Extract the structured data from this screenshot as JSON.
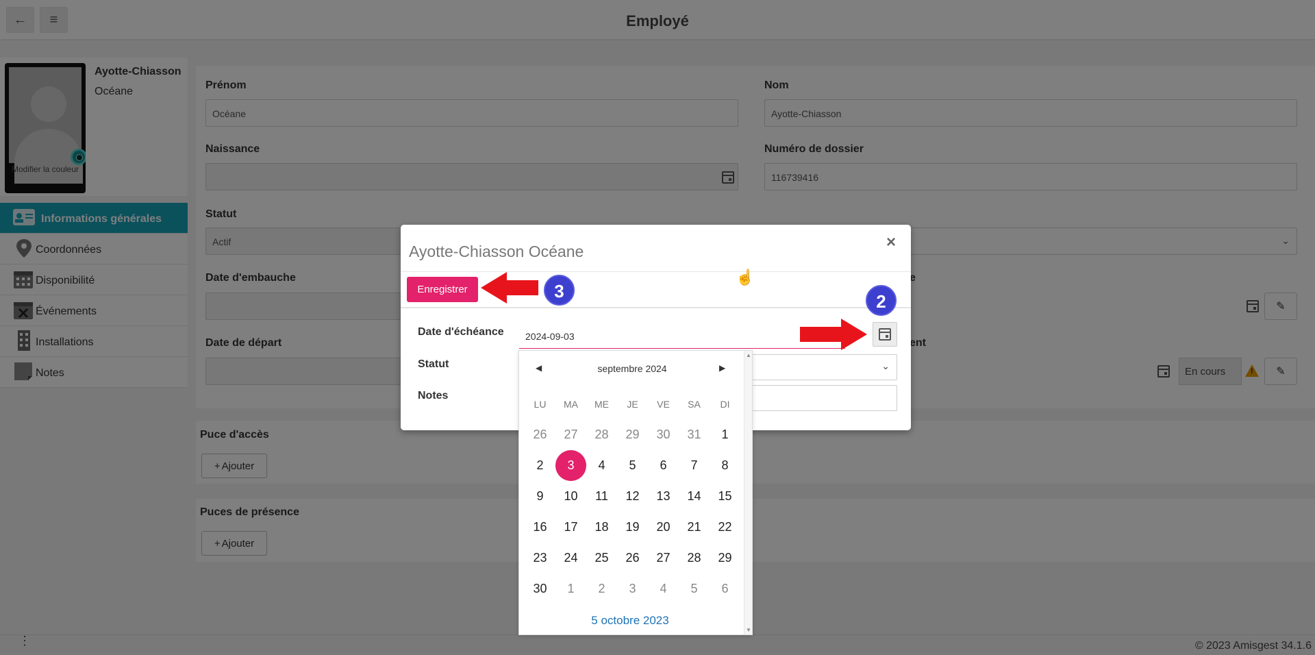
{
  "topbar": {
    "title": "Employé",
    "back_icon": "←",
    "menu_icon": "≡"
  },
  "profile": {
    "last_name": "Ayotte-Chiasson",
    "first_name": "Océane",
    "photo_caption": "Modifier la couleur"
  },
  "sidenav": {
    "items": [
      {
        "label": "Informations générales",
        "icon": "id-card-icon"
      },
      {
        "label": "Coordonnées",
        "icon": "map-marker-icon"
      },
      {
        "label": "Disponibilité",
        "icon": "calendar-icon"
      },
      {
        "label": "Événements",
        "icon": "calendar-x-icon"
      },
      {
        "label": "Installations",
        "icon": "building-icon"
      },
      {
        "label": "Notes",
        "icon": "note-icon"
      }
    ]
  },
  "form": {
    "prenom_label": "Prénom",
    "prenom_value": "Océane",
    "nom_label": "Nom",
    "nom_value": "Ayotte-Chiasson",
    "naissance_label": "Naissance",
    "dossier_label": "Numéro de dossier",
    "dossier_value": "116739416",
    "statut_label": "Statut",
    "statut_value": "Actif",
    "embauche_label": "Date d'embauche",
    "depart_label": "Date de départ",
    "right_label_1": "e",
    "right_label_2": "ent",
    "en_cours": "En cours"
  },
  "sections": {
    "puce_acces_title": "Puce d'accès",
    "puces_presence_title": "Puces de présence",
    "add_label": "Ajouter"
  },
  "modal": {
    "title": "Ayotte-Chiasson Océane",
    "close": "×",
    "save_label": "Enregistrer",
    "date_label": "Date d'échéance",
    "date_value": "2024-09-03",
    "statut_label": "Statut",
    "notes_label": "Notes"
  },
  "datepicker": {
    "month_label": "septembre 2024",
    "prev": "◀",
    "next": "▶",
    "weekdays": [
      "LU",
      "MA",
      "ME",
      "JE",
      "VE",
      "SA",
      "DI"
    ],
    "weeks": [
      [
        "26",
        "27",
        "28",
        "29",
        "30",
        "31",
        "1"
      ],
      [
        "2",
        "3",
        "4",
        "5",
        "6",
        "7",
        "8"
      ],
      [
        "9",
        "10",
        "11",
        "12",
        "13",
        "14",
        "15"
      ],
      [
        "16",
        "17",
        "18",
        "19",
        "20",
        "21",
        "22"
      ],
      [
        "23",
        "24",
        "25",
        "26",
        "27",
        "28",
        "29"
      ],
      [
        "30",
        "1",
        "2",
        "3",
        "4",
        "5",
        "6"
      ]
    ],
    "selected_day": "3",
    "today_label": "5 octobre 2023"
  },
  "annotations": {
    "badge_2": "2",
    "badge_3": "3",
    "arrow_color": "#e8141c",
    "badge_color": "#3d3fcf"
  },
  "footer": {
    "copyright": "© 2023 Amisgest 34.1.6",
    "menu_dots": "⋮"
  },
  "colors": {
    "accent_pink": "#e3226b",
    "nav_active": "#17a2b8",
    "link_blue": "#1f73b7"
  }
}
